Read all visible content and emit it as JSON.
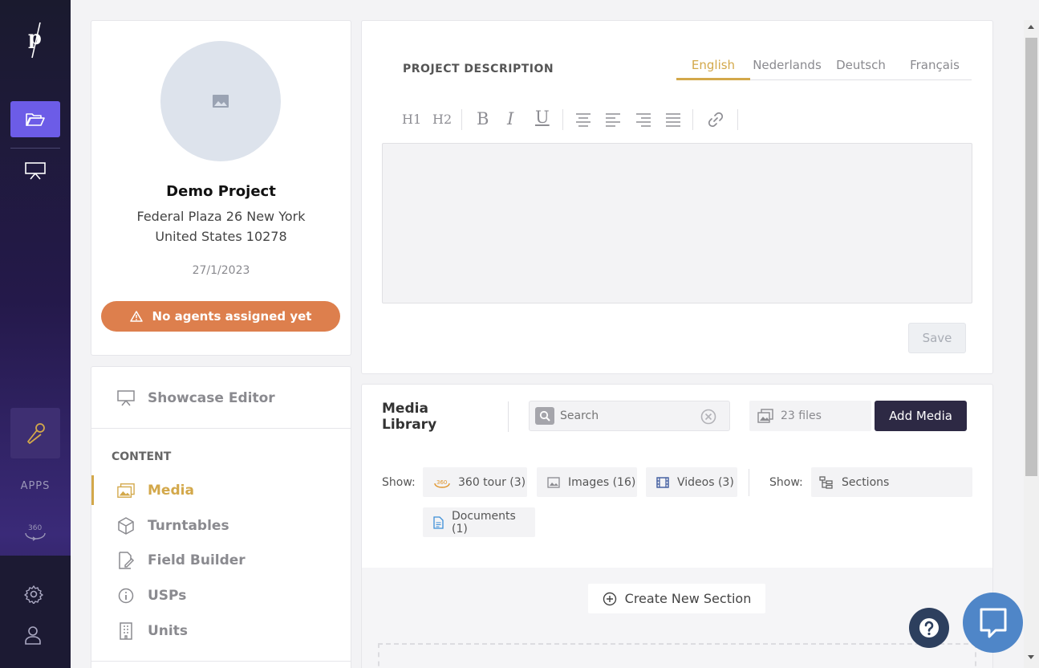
{
  "rail": {
    "logo_letter": "p",
    "apps_label": "APPS",
    "icon_360": "360"
  },
  "project": {
    "name": "Demo Project",
    "address": "Federal Plaza 26 New York United States 10278",
    "date": "27/1/2023",
    "agents_warning": "No agents assigned yet"
  },
  "nav": {
    "showcase_editor": "Showcase Editor",
    "section_label": "CONTENT",
    "items": [
      {
        "label": "Media",
        "icon": "media-icon"
      },
      {
        "label": "Turntables",
        "icon": "cube-icon"
      },
      {
        "label": "Field Builder",
        "icon": "field-builder-icon"
      },
      {
        "label": "USPs",
        "icon": "info-icon"
      },
      {
        "label": "Units",
        "icon": "building-icon"
      }
    ]
  },
  "description": {
    "heading": "PROJECT DESCRIPTION",
    "tabs": [
      "English",
      "Nederlands",
      "Deutsch",
      "Français"
    ],
    "active_tab": "English",
    "toolbar": {
      "h1": "H1",
      "h2": "H2",
      "bold": "B",
      "italic": "I",
      "underline": "U"
    },
    "save_label": "Save"
  },
  "media": {
    "title": "Media Library",
    "search_placeholder": "Search",
    "file_count": "23 files",
    "add_label": "Add Media",
    "show_label": "Show:",
    "filters": [
      {
        "label": "360 tour (3)",
        "icon": "360-tour-icon"
      },
      {
        "label": "Images (16)",
        "icon": "image-icon"
      },
      {
        "label": "Videos (3)",
        "icon": "film-icon"
      },
      {
        "label": "Documents (1)",
        "icon": "document-icon"
      }
    ],
    "show_label_2": "Show:",
    "sections_label": "Sections",
    "create_section": "Create New Section"
  },
  "colors": {
    "accent": "#d3a84a",
    "rail_active": "#6c5ce7",
    "warning": "#dd7f4d",
    "add_button": "#2d2944"
  }
}
